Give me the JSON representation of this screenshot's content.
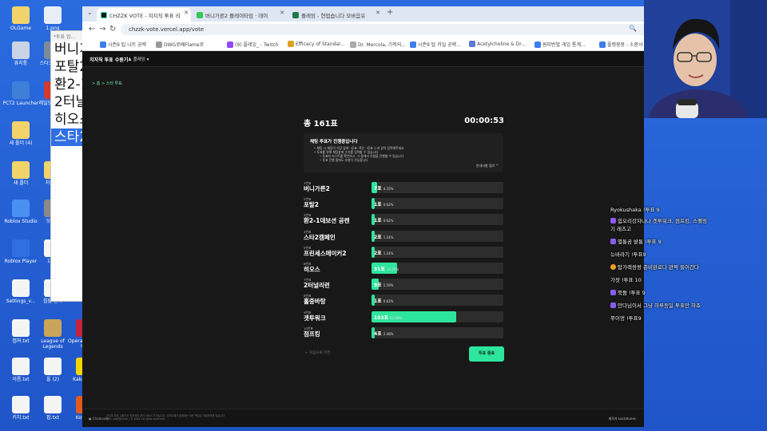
{
  "desktop": {
    "icons": [
      {
        "label": "OLGame",
        "color": "#f2d36b"
      },
      {
        "label": "1.png",
        "color": "#e9eef6"
      },
      {
        "label": "휴지통",
        "color": "#c8d4e6"
      },
      {
        "label": "스타크래프트",
        "color": "#7d8c9a"
      },
      {
        "label": "PCT2 Launcher",
        "color": "#3f7fd8"
      },
      {
        "label": "레일모턴 사원",
        "color": "#d33a2c"
      },
      {
        "label": "새 폴더 (4)",
        "color": "#f2d36b"
      },
      {
        "label": "새 폴더",
        "color": "#f2d36b"
      },
      {
        "label": "저장 업",
        "color": "#f2d36b"
      },
      {
        "label": "Roblox Studio",
        "color": "#4a8ff2"
      },
      {
        "label": "모마니",
        "color": "#8a8a8a"
      },
      {
        "label": "Roblox Player",
        "color": "#2f6fe3"
      },
      {
        "label": "1.txt",
        "color": "#f4f4f4"
      },
      {
        "label": "Settings_v...",
        "color": "#f4f4f4"
      },
      {
        "label": "칩할 원자",
        "color": "#f4f4f4"
      },
      {
        "label": "캡쳐.txt",
        "color": "#f4f4f4"
      },
      {
        "label": "League of Legends",
        "color": "#c8a55a"
      },
      {
        "label": "Opera GX 브라우저",
        "color": "#c3243a"
      },
      {
        "label": "이름.txt",
        "color": "#f4f4f4"
      },
      {
        "label": "올 (2)",
        "color": "#f4f4f4"
      },
      {
        "label": "KakaoTalk",
        "color": "#f4d400"
      },
      {
        "label": "키치.txt",
        "color": "#f4f4f4"
      },
      {
        "label": "팝.txt",
        "color": "#f4f4f4"
      },
      {
        "label": "KovaaK",
        "color": "#e25a1c"
      }
    ]
  },
  "notepad": {
    "title": "*투표 업...",
    "lines": [
      "버니가",
      "포탈2",
      "환2-1",
      "2터날",
      "히오스",
      "스타2"
    ],
    "selected_index": 5
  },
  "browser": {
    "tabs": [
      {
        "label": "CHZZK VOTE - 치지직 투표 리",
        "active": true,
        "color": "#0e1a14"
      },
      {
        "label": "버니가른2 플레이타임 · 데이",
        "active": false,
        "color": "#35c759"
      },
      {
        "label": "플레잉 - 현업습니다 모바음유",
        "active": false,
        "color": "#1f7a48"
      }
    ],
    "new_tab": "+",
    "url": "chzzk-vote.vercel.app/vote",
    "window_controls": [
      "—",
      "▢",
      "✕"
    ],
    "bookmarks": [
      {
        "label": "시즌9 팁 나트 공략",
        "color": "#3d7ee8"
      },
      {
        "label": "DWG로배Flame로",
        "color": "#999999"
      },
      {
        "label": "(9) 플레잉_ - Twitch",
        "color": "#9146ff"
      },
      {
        "label": "Efficacy of Standar...",
        "color": "#e0a020"
      },
      {
        "label": "Dr. Mercola, 기적의...",
        "color": "#aaaaaa"
      },
      {
        "label": "시즌9 탑 카일 공략...",
        "color": "#3d7ee8"
      },
      {
        "label": "Acetylcholine & Dr...",
        "color": "#5a7ad6"
      },
      {
        "label": "원피번벌 게임 통계...",
        "color": "#3d7ee8"
      },
      {
        "label": "플랫뭉뭉 - 소환사",
        "color": "#3d7ee8"
      }
    ]
  },
  "app": {
    "title": "치지직 투표 수원기",
    "user": "플레잉",
    "breadcrumb": "> 홈 > 스타 투표",
    "total_label": "총 161표",
    "timer": "00:00:53",
    "info": {
      "title": "채팅 투표가 진행중입니다",
      "lines": [
        "• 채팅 시 채팅이 가장 앞에 '!투표' 혹은 '!투표 1'과 같이 입력해주세요",
        "• 투표를 위해 채팅창에 숫자를 입력할 수 있습니다",
        "• 투표자 리스트를 확인하고, 그 중에서 추첨을 진행할 수 있습니다",
        "• 투표 진행 중에도 추첨이 가능합니다"
      ],
      "more": "안내사항 접기 ^"
    },
    "options": [
      {
        "num": "1번표",
        "name": "버니가른2",
        "count": "7표",
        "pct": "4.35%",
        "ratio": 0.0435
      },
      {
        "num": "2번표",
        "name": "포탈2",
        "count": "1표",
        "pct": "0.62%",
        "ratio": 0.0062
      },
      {
        "num": "3번표",
        "name": "환2-1데보션 공켄",
        "count": "1표",
        "pct": "0.62%",
        "ratio": 0.0062
      },
      {
        "num": "4번표",
        "name": "스타2캠페인",
        "count": "2표",
        "pct": "1.24%",
        "ratio": 0.0124
      },
      {
        "num": "5번표",
        "name": "프린세스메이커2",
        "count": "2표",
        "pct": "1.24%",
        "ratio": 0.0124
      },
      {
        "num": "6번표",
        "name": "히오스",
        "count": "31표",
        "pct": "19.25%",
        "ratio": 0.1925
      },
      {
        "num": "7번표",
        "name": "2터널리런",
        "count": "9표",
        "pct": "5.59%",
        "ratio": 0.0559
      },
      {
        "num": "8번표",
        "name": "홀중바탕",
        "count": "1표",
        "pct": "0.62%",
        "ratio": 0.0062
      },
      {
        "num": "9번표",
        "name": "겟투워크",
        "count": "103표",
        "pct": "63.98%",
        "ratio": 0.6398
      },
      {
        "num": "10번표",
        "name": "점프킹",
        "count": "4표",
        "pct": "2.48%",
        "ratio": 0.0248
      }
    ],
    "back_link": "← 처음으로 이전",
    "end_button": "투표 종료",
    "footer": {
      "logo": "● Chzzkvote",
      "text1": "치지직 투표 수원기는 치지직의 공식 서비스가 아닙니다. 사이트에서 발생하는 모든 책임은 개발자에게 있습니다",
      "text2": "문의: vote@chzzk / © 2024 All rights reserved.",
      "right": "제작자 Lactatunes"
    }
  },
  "chat": [
    {
      "text": "Ryokushaka !투표 9",
      "badge": "none"
    },
    {
      "text": "힘오리강자나나 겟투워크, 점프킹, 스펠링",
      "badge": "sub"
    },
    {
      "text": "기 레츠고",
      "badge": "none"
    },
    {
      "text": "별통곰 밭통 !투표 9",
      "badge": "sub"
    },
    {
      "text": "뉴바라기 !투표9",
      "badge": "none"
    },
    {
      "text": "탑가렉쌍쌍 준비완료다 관짝 들어간다",
      "badge": "fire"
    },
    {
      "text": "가잣 !투표 10",
      "badge": "none"
    },
    {
      "text": "묵둠 !투표 9",
      "badge": "sub"
    },
    {
      "text": "만다님이서 그냥 하루동일 투표만 하죠",
      "badge": "sub"
    },
    {
      "text": "쭈이엉 !투표9",
      "badge": "none"
    }
  ]
}
